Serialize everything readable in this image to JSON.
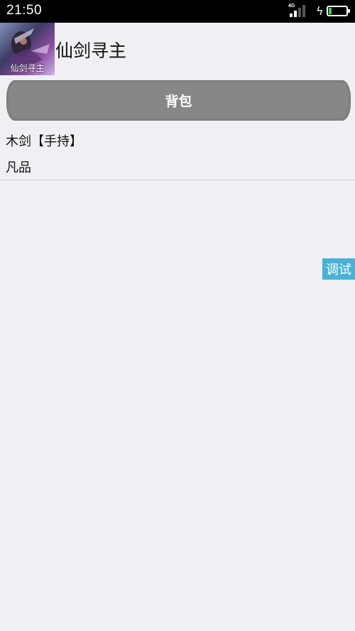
{
  "status_bar": {
    "time": "21:50",
    "network": "4G",
    "signal_icon": "signal-icon",
    "charging_icon": "lightning-icon",
    "battery_icon": "battery-icon",
    "battery_color": "#3ad14a"
  },
  "header": {
    "logo_caption": "仙剑寻主",
    "title": "仙剑寻主"
  },
  "bag_button": {
    "label": "背包"
  },
  "item": {
    "name": "木剑【手持】",
    "grade": "凡品"
  },
  "debug_button": {
    "label": "调试",
    "color": "#4ab2d6"
  }
}
